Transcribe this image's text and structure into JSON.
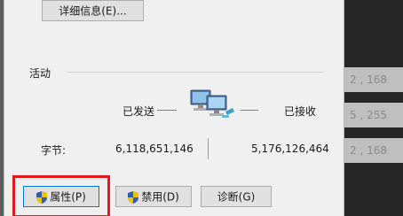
{
  "buttons": {
    "details": "详细信息(E)...",
    "properties": "属性(P)",
    "disable": "禁用(D)",
    "diagnose": "诊断(G)"
  },
  "activity": {
    "title": "活动",
    "sent_label": "已发送",
    "received_label": "已接收",
    "bytes_label": "字节:",
    "bytes_sent": "6,118,651,146",
    "bytes_received": "5,176,126,464"
  },
  "background": {
    "stripe_texts": [
      "2 , 168",
      "5 , 255",
      "2 , 168"
    ]
  },
  "colors": {
    "highlight": "#e01b1b",
    "shield_blue": "#2b5fb3",
    "shield_yellow": "#f2c200"
  },
  "icons": {
    "network": "network-connection-icon",
    "shield": "uac-shield-icon"
  }
}
